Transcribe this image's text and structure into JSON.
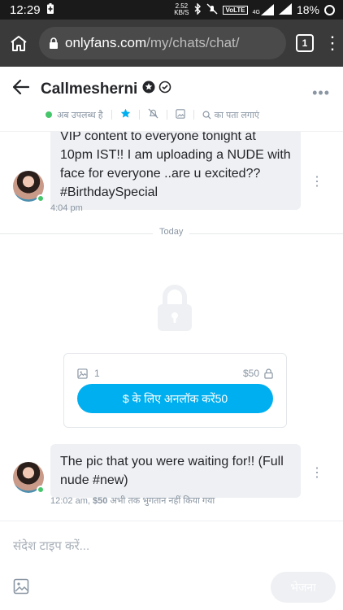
{
  "status_bar": {
    "time": "12:29",
    "net_speed": "2.52",
    "net_unit": "KB/S",
    "volte": "VoLTE",
    "signal": "4G",
    "battery": "18%"
  },
  "browser": {
    "url_host": "onlyfans.com",
    "url_path": "/my/chats/chat/",
    "tab_count": "1"
  },
  "chat_header": {
    "name": "Callmesherni",
    "online_status": "अब उपलब्ध है",
    "search_label": "का पता लगाएं"
  },
  "messages": [
    {
      "text": "VIP content to everyone tonight at 10pm IST!! I am uploading a NUDE with face for everyone ..are u excited?? #BirthdaySpecial",
      "time": "4:04 pm"
    },
    {
      "text": "The pic that you were waiting for!! (Full nude #new)",
      "time": "12:02 am,",
      "price_note": "$50",
      "status_note": "अभी तक भुगतान नहीं किया गया"
    }
  ],
  "divider_label": "Today",
  "ppv": {
    "media_count": "1",
    "price": "$50",
    "unlock_label": "$ के लिए अनलॉक करें50"
  },
  "composer": {
    "placeholder": "संदेश टाइप करें...",
    "send_label": "भेजना"
  },
  "colors": {
    "accent": "#00aff0",
    "online": "#45c66b",
    "bubble": "#eef0f3",
    "muted": "#8a96a3"
  }
}
